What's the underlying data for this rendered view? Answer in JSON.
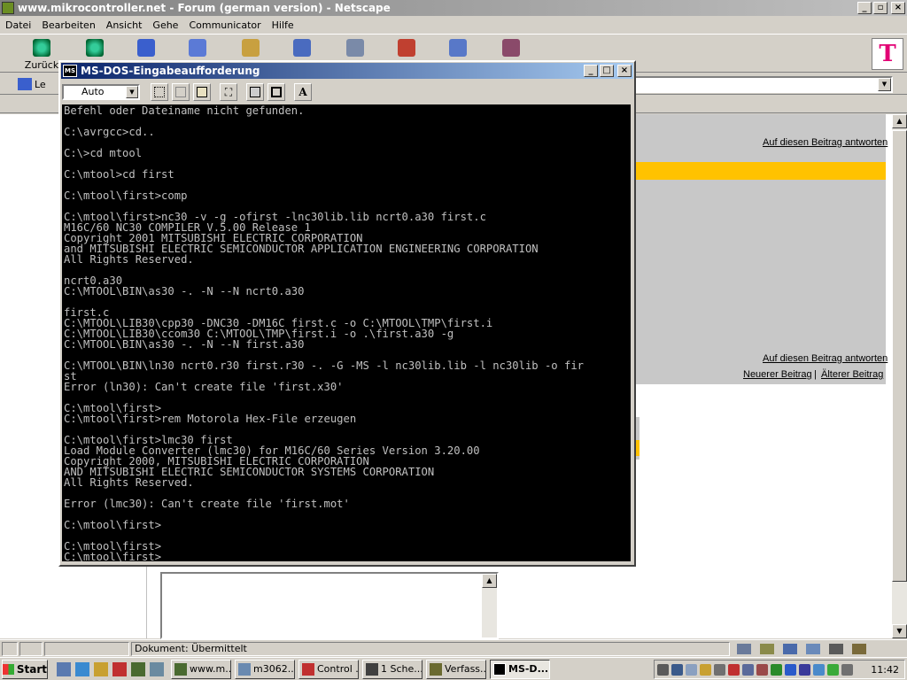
{
  "browser": {
    "title": "www.mikrocontroller.net - Forum (german version) - Netscape",
    "menu": [
      "Datei",
      "Bearbeiten",
      "Ansicht",
      "Gehe",
      "Communicator",
      "Hilfe"
    ],
    "nav_back": "Zurück",
    "location_label": "Le",
    "status_text": "Dokument: Übermittelt",
    "links": {
      "reply_top": "Auf diesen Beitrag antworten",
      "reply_bottom": "Auf diesen Beitrag antworten",
      "newer": "Neuerer Beitrag",
      "sep": "|",
      "older": "Älterer Beitrag"
    }
  },
  "dos": {
    "title": "MS-DOS-Eingabeaufforderung",
    "font_select": "Auto",
    "lines": [
      "Befehl oder Dateiname nicht gefunden.",
      "",
      "C:\\avrgcc>cd..",
      "",
      "C:\\>cd mtool",
      "",
      "C:\\mtool>cd first",
      "",
      "C:\\mtool\\first>comp",
      "",
      "C:\\mtool\\first>nc30 -v -g -ofirst -lnc30lib.lib ncrt0.a30 first.c",
      "M16C/60 NC30 COMPILER V.5.00 Release 1",
      "Copyright 2001 MITSUBISHI ELECTRIC CORPORATION",
      "and MITSUBISHI ELECTRIC SEMICONDUCTOR APPLICATION ENGINEERING CORPORATION",
      "All Rights Reserved.",
      "",
      "ncrt0.a30",
      "C:\\MTOOL\\BIN\\as30 -. -N --N ncrt0.a30",
      "",
      "first.c",
      "C:\\MTOOL\\LIB30\\cpp30 -DNC30 -DM16C first.c -o C:\\MTOOL\\TMP\\first.i",
      "C:\\MTOOL\\LIB30\\ccom30 C:\\MTOOL\\TMP\\first.i -o .\\first.a30 -g",
      "C:\\MTOOL\\BIN\\as30 -. -N --N first.a30",
      "",
      "C:\\MTOOL\\BIN\\ln30 ncrt0.r30 first.r30 -. -G -MS -l nc30lib.lib -l nc30lib -o fir",
      "st",
      "Error (ln30): Can't create file 'first.x30'",
      "",
      "C:\\mtool\\first>",
      "C:\\mtool\\first>rem Motorola Hex-File erzeugen",
      "",
      "C:\\mtool\\first>lmc30 first",
      "Load Module Converter (lmc30) for M16C/60 Series Version 3.20.00",
      "Copyright 2000, MITSUBISHI ELECTRIC CORPORATION",
      "AND MITSUBISHI ELECTRIC SEMICONDUCTOR SYSTEMS CORPORATION",
      "All Rights Reserved.",
      "",
      "Error (lmc30): Can't create file 'first.mot'",
      "",
      "C:\\mtool\\first>",
      "",
      "C:\\mtool\\first>",
      "C:\\mtool\\first>_"
    ]
  },
  "taskbar": {
    "start": "Start",
    "tasks": [
      "www.m...",
      "m3062...",
      "Control ...",
      "1 Sche...",
      "Verfass...",
      "MS-D..."
    ],
    "clock": "11:42"
  },
  "colors": {
    "dos_titlebar": "#0a246a",
    "highlight_bar": "#ffc200"
  }
}
